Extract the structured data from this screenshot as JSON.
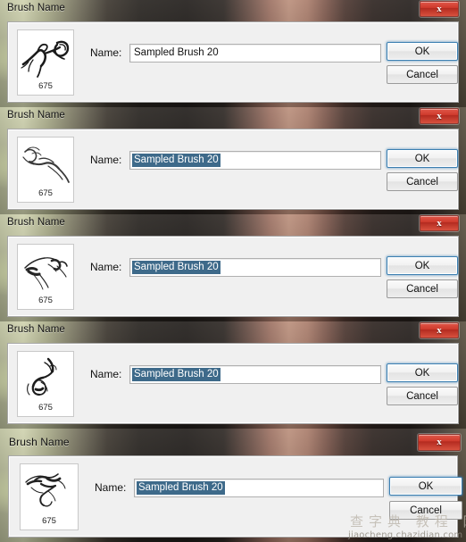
{
  "app": {
    "dialog_title": "Brush Name",
    "close_label": "x",
    "name_label": "Name:",
    "brush_value": "Sampled Brush 20",
    "brush_size": "675",
    "ok_label": "OK",
    "cancel_label": "Cancel",
    "selection_color": "#3e6a8a",
    "focus_color": "#3c7fb1",
    "close_color": "#cf3a2c"
  },
  "watermark": {
    "chinese": "查字典 教程 网",
    "url": "jiaocheng.chazidian.com"
  },
  "panels": [
    {
      "title": "Brush Name",
      "name_label": "Name:",
      "value": "Sampled Brush 20",
      "size": "675",
      "selected": false,
      "ok": "OK",
      "cancel": "Cancel"
    },
    {
      "title": "Brush Name",
      "name_label": "Name:",
      "value": "Sampled Brush 20",
      "size": "675",
      "selected": true,
      "ok": "OK",
      "cancel": "Cancel"
    },
    {
      "title": "Brush Name",
      "name_label": "Name:",
      "value": "Sampled Brush 20",
      "size": "675",
      "selected": true,
      "ok": "OK",
      "cancel": "Cancel"
    },
    {
      "title": "Brush Name",
      "name_label": "Name:",
      "value": "Sampled Brush 20",
      "size": "675",
      "selected": true,
      "ok": "OK",
      "cancel": "Cancel"
    },
    {
      "title": "Brush Name",
      "name_label": "Name:",
      "value": "Sampled Brush 20",
      "size": "675",
      "selected": true,
      "ok": "OK",
      "cancel": "Cancel"
    }
  ]
}
